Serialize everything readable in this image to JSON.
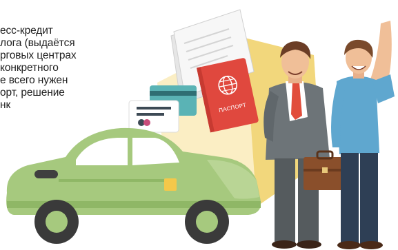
{
  "caption": {
    "text": "есс-кредит\nлога (выдаётся\nрговых центрах\nконкретного\nе всего нужен\nорт, решение\nнк"
  },
  "passport": {
    "label": "ПАСПОРТ"
  },
  "colors": {
    "background": "#ffffff",
    "hexagon_light": "#fbeec4",
    "hexagon_dark": "#f2d77c",
    "car_body": "#a6c97e",
    "car_body_dark": "#8fb766",
    "passport": "#e0483e",
    "bank_card": "#5ab3b5",
    "suit": "#6d7478",
    "tie": "#e14d3b",
    "shirt_blue": "#5fa7cf",
    "briefcase": "#8a4f2b"
  },
  "icons": [
    "globe-icon",
    "document-icon",
    "bank-card-icon",
    "id-card-icon"
  ]
}
